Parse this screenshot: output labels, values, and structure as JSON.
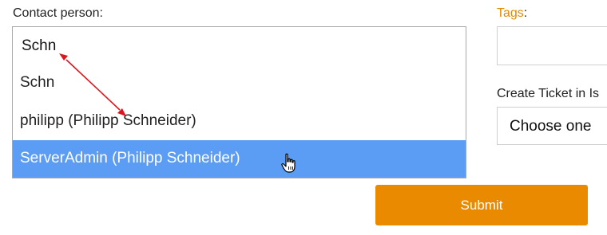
{
  "form": {
    "contact_label": "Contact person:",
    "contact_value": "Schn",
    "tags_label": "Tags",
    "tags_colon": ":",
    "create_ticket_label": "Create Ticket in Is",
    "ticket_select_value": "Choose one",
    "submit_label": "Submit"
  },
  "suggestions": [
    {
      "label": "Schn",
      "highlighted": false
    },
    {
      "label": "philipp (Philipp Schneider)",
      "highlighted": false
    },
    {
      "label": "ServerAdmin (Philipp Schneider)",
      "highlighted": true
    }
  ],
  "colors": {
    "accent": "#e08a00",
    "submit_background": "#ea8a00",
    "highlight_background": "#5b9cf4",
    "annotation_arrow": "#e0141e"
  },
  "icons": {
    "cursor": "hand-pointer-icon"
  }
}
